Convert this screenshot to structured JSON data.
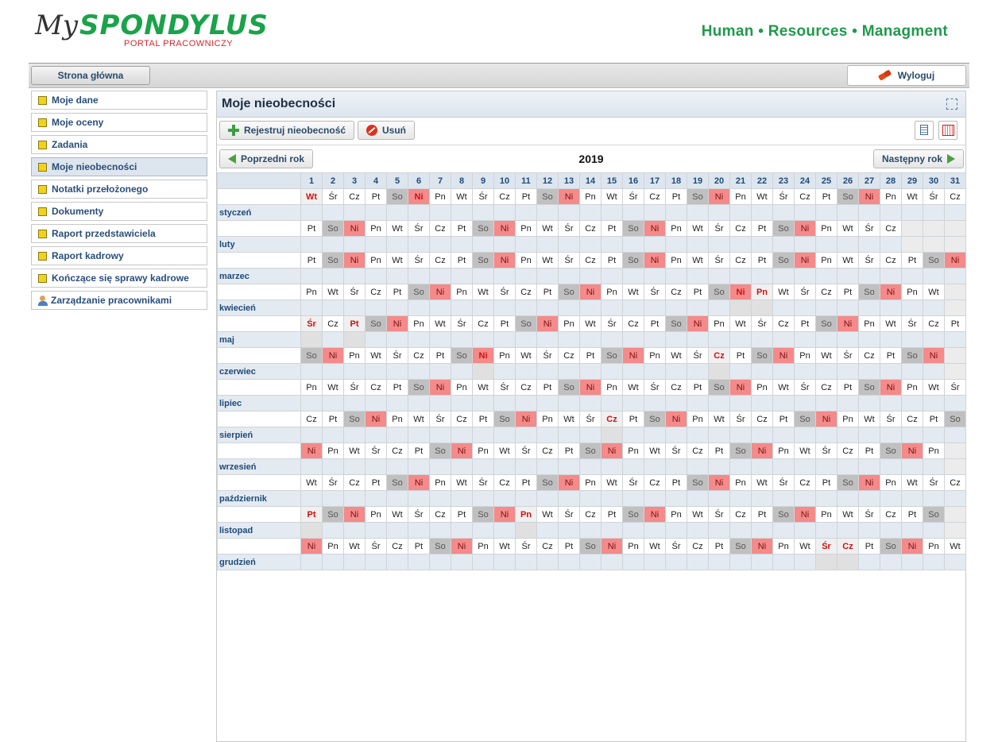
{
  "header": {
    "logo_my": "My",
    "logo_main": "SPONDYLUS",
    "logo_sub": "PORTAL PRACOWNICZY",
    "tagline": "Human • Resources • Managment"
  },
  "topbar": {
    "home_label": "Strona główna",
    "logout_label": "Wyloguj"
  },
  "sidebar": {
    "items": [
      {
        "label": "Moje dane",
        "icon": "folder-icon"
      },
      {
        "label": "Moje oceny",
        "icon": "folder-icon"
      },
      {
        "label": "Zadania",
        "icon": "folder-icon"
      },
      {
        "label": "Moje nieobecności",
        "icon": "folder-icon",
        "active": true
      },
      {
        "label": "Notatki przełożonego",
        "icon": "folder-icon"
      },
      {
        "label": "Dokumenty",
        "icon": "folder-icon"
      },
      {
        "label": "Raport przedstawiciela",
        "icon": "folder-icon"
      },
      {
        "label": "Raport kadrowy",
        "icon": "folder-icon"
      },
      {
        "label": "Kończące się sprawy kadrowe",
        "icon": "folder-icon"
      },
      {
        "label": "Zarządzanie pracownikami",
        "icon": "people-icon"
      }
    ]
  },
  "panel": {
    "title": "Moje nieobecności",
    "register_label": "Rejestruj nieobecność",
    "delete_label": "Usuń",
    "prev_label": "Poprzedni rok",
    "next_label": "Następny rok",
    "year": "2019"
  },
  "colors": {
    "weekend": "#c0c0c0",
    "sunday": "#f48a8a",
    "holiday_text": "#d01010",
    "header_bg": "#dde5ee"
  },
  "calendar": {
    "days": [
      1,
      2,
      3,
      4,
      5,
      6,
      7,
      8,
      9,
      10,
      11,
      12,
      13,
      14,
      15,
      16,
      17,
      18,
      19,
      20,
      21,
      22,
      23,
      24,
      25,
      26,
      27,
      28,
      29,
      30,
      31
    ],
    "months": [
      {
        "name": "styczeń",
        "first": "Wt",
        "length": 31,
        "holidays": [
          1,
          6
        ],
        "marked": []
      },
      {
        "name": "luty",
        "first": "Pt",
        "length": 28,
        "holidays": [],
        "marked": []
      },
      {
        "name": "marzec",
        "first": "Pt",
        "length": 31,
        "holidays": [],
        "marked": []
      },
      {
        "name": "kwiecień",
        "first": "Pn",
        "length": 30,
        "holidays": [
          21,
          22
        ],
        "marked": [
          21,
          22
        ]
      },
      {
        "name": "maj",
        "first": "Śr",
        "length": 31,
        "holidays": [
          1,
          3
        ],
        "marked": [
          1,
          3
        ]
      },
      {
        "name": "czerwiec",
        "first": "So",
        "length": 30,
        "holidays": [
          9,
          20
        ],
        "marked": [
          9,
          20
        ]
      },
      {
        "name": "lipiec",
        "first": "Pn",
        "length": 31,
        "holidays": [],
        "marked": []
      },
      {
        "name": "sierpień",
        "first": "Cz",
        "length": 31,
        "holidays": [
          15
        ],
        "marked": [
          15
        ]
      },
      {
        "name": "wrzesień",
        "first": "Ni",
        "length": 30,
        "holidays": [],
        "marked": []
      },
      {
        "name": "październik",
        "first": "Wt",
        "length": 31,
        "holidays": [],
        "marked": []
      },
      {
        "name": "listopad",
        "first": "Pt",
        "length": 30,
        "holidays": [
          1,
          11
        ],
        "marked": [
          1,
          11
        ]
      },
      {
        "name": "grudzień",
        "first": "Ni",
        "length": 31,
        "holidays": [
          25,
          26
        ],
        "marked": [
          25,
          26
        ]
      }
    ],
    "weekdays": [
      "Pn",
      "Wt",
      "Śr",
      "Cz",
      "Pt",
      "So",
      "Ni"
    ]
  }
}
